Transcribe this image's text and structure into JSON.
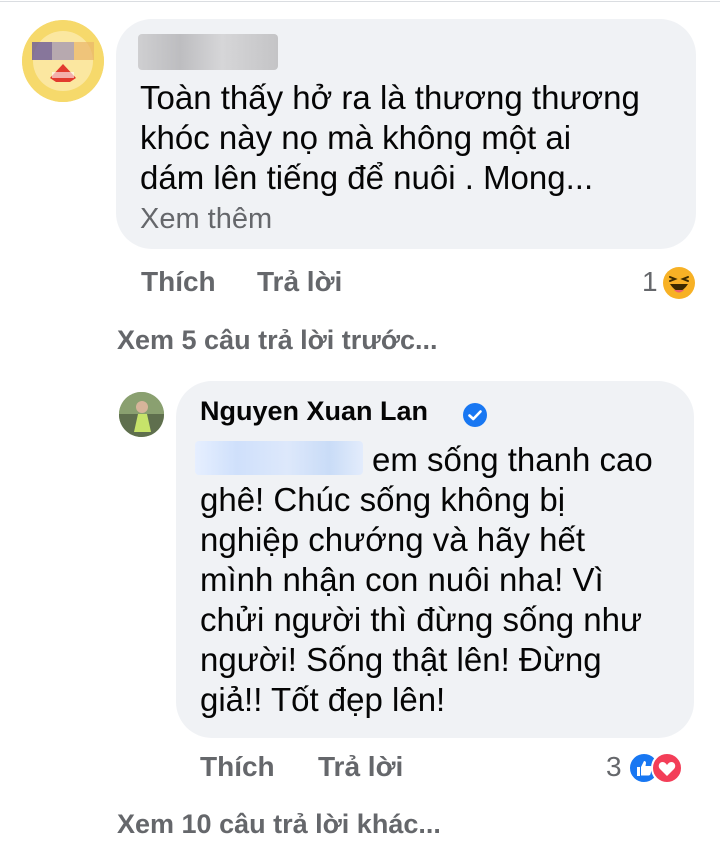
{
  "comment1": {
    "text": "Toàn thấy hở ra là thương thương\nkhóc này nọ mà không một ai\ndám lên tiếng để nuôi . Mong...",
    "see_more": "Xem thêm",
    "like_label": "Thích",
    "reply_label": "Trả lời",
    "reaction_count": "1",
    "reaction_icon": "haha-reaction-icon"
  },
  "view_previous_replies": "Xem 5 câu trả lời trước...",
  "reply1": {
    "author": "Nguyen Xuan Lan",
    "verified_icon": "verified-badge-icon",
    "text": "em sống thanh cao\nghê! Chúc sống không bị\nnghiệp chướng và hãy hết\nmình nhận con nuôi nha! Vì\nchửi người thì đừng sống như\nngười! Sống thật lên! Đừng\ngiả!! Tốt đẹp lên!",
    "like_label": "Thích",
    "reply_label": "Trả lời",
    "reaction_count": "3",
    "reaction_icons": [
      "like-reaction-icon",
      "love-reaction-icon"
    ]
  },
  "view_more_replies": "Xem 10 câu trả lời khác...",
  "colors": {
    "bubble": "#f0f2f5",
    "secondary_text": "#65676b",
    "like_blue": "#1877f2",
    "love_red": "#f33e58",
    "haha_yellow": "#f7b125"
  }
}
